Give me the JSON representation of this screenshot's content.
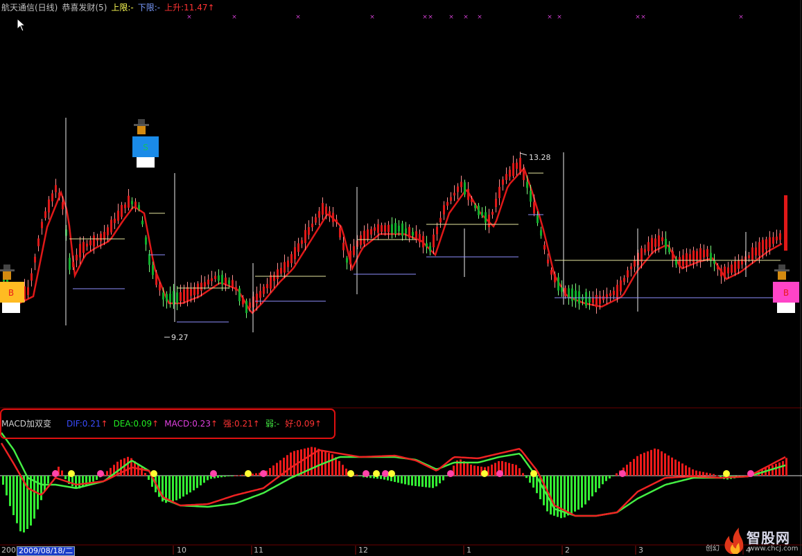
{
  "header": {
    "stock": "航天通信(日线)",
    "formula": "恭喜发财(5)",
    "upper": "上限:-",
    "lower": "下限:-",
    "rise": "上升:11.47",
    "rise_arrow": "↑"
  },
  "indicator": {
    "name": "MACD加双变",
    "dif": "DIF:0.21",
    "dea": "DEA:0.09",
    "macd": "MACD:0.23",
    "strong": "强:0.21",
    "weak": "弱:-",
    "good": "好:0.09",
    "arrow": "↑"
  },
  "price_labels": {
    "high": "13.28",
    "low": "9.27"
  },
  "signals": {
    "sell": "S",
    "buy": "B"
  },
  "axis": {
    "start": "200",
    "selected_date": "2009/08/18/二",
    "months": [
      "10",
      "11",
      "12",
      "1",
      "2",
      "3",
      "4"
    ]
  },
  "watermark": {
    "brand": "智股网",
    "url": "www.chcj.com",
    "left_text": "创幻"
  },
  "colors": {
    "up": "#e01818",
    "down": "#0fae2c",
    "macd_up": "#ee1a1a",
    "macd_down": "#33ee33",
    "dif_line": "#ee2222",
    "dea_line": "#44ee44",
    "yellow_dot": "#ffff33",
    "pink_dot": "#ff44aa",
    "header_title": "#c0c0c0",
    "dif_text": "#3a4cff",
    "dea_text": "#22ee22",
    "macd_text": "#e040e0",
    "strong_text": "#ff3333",
    "weak_text": "#44ee44",
    "good_text": "#ff3333"
  },
  "icons": {
    "cursor": "mouse-pointer-icon",
    "sell_figure": "sell-person-icon",
    "buy_figure": "buy-person-icon",
    "flame": "flame-logo-icon"
  }
}
